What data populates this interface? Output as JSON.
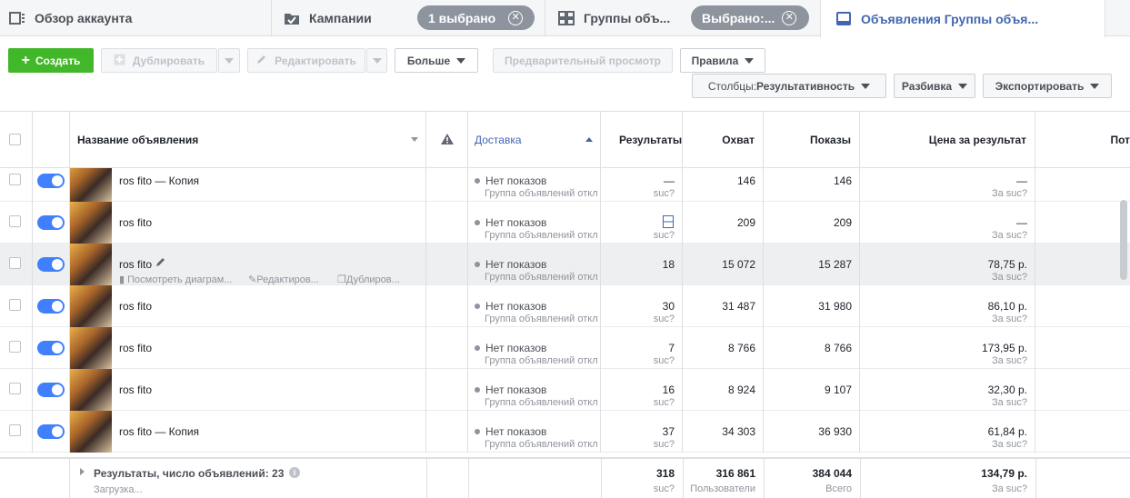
{
  "tabs": {
    "overview": "Обзор аккаунта",
    "campaigns": "Кампании",
    "campaigns_pill": "1 выбрано",
    "adsets": "Группы объ...",
    "adsets_pill": "Выбрано:...",
    "ads": "Объявления Группы объя..."
  },
  "toolbar": {
    "create": "Создать",
    "duplicate": "Дублировать",
    "edit": "Редактировать",
    "more": "Больше",
    "preview": "Предварительный просмотр",
    "rules": "Правила",
    "columns_label": "Столбцы: ",
    "columns_value": "Результативность",
    "breakdown": "Разбивка",
    "export": "Экспортировать"
  },
  "columns": {
    "name": "Название объявления",
    "delivery": "Доставка",
    "results": "Результаты",
    "reach": "Охват",
    "impressions": "Показы",
    "cost": "Цена за результат",
    "last": "Пот"
  },
  "rows": [
    {
      "name": "ros fito — Копия",
      "delivery": "Нет показов",
      "delivery_sub": "Группа объявлений откл",
      "results": "—",
      "results_sub": "suc?",
      "reach": "146",
      "impressions": "146",
      "cost": "—",
      "cost_sub": "За suc?"
    },
    {
      "name": "ros fito",
      "delivery": "Нет показов",
      "delivery_sub": "Группа объявлений откл",
      "results": "",
      "results_sub": "suc?",
      "reach": "209",
      "impressions": "209",
      "cost": "—",
      "cost_sub": "За suc?"
    },
    {
      "name": "ros fito",
      "delivery": "Нет показов",
      "delivery_sub": "Группа объявлений откл",
      "results": "18",
      "results_sub": "",
      "reach": "15 072",
      "impressions": "15 287",
      "cost": "78,75 р.",
      "cost_sub": "За suc?"
    },
    {
      "name": "ros fito",
      "delivery": "Нет показов",
      "delivery_sub": "Группа объявлений откл",
      "results": "30",
      "results_sub": "suc?",
      "reach": "31 487",
      "impressions": "31 980",
      "cost": "86,10 р.",
      "cost_sub": "За suc?"
    },
    {
      "name": "ros fito",
      "delivery": "Нет показов",
      "delivery_sub": "Группа объявлений откл",
      "results": "7",
      "results_sub": "suc?",
      "reach": "8 766",
      "impressions": "8 766",
      "cost": "173,95 р.",
      "cost_sub": "За suc?"
    },
    {
      "name": "ros fito",
      "delivery": "Нет показов",
      "delivery_sub": "Группа объявлений откл",
      "results": "16",
      "results_sub": "suc?",
      "reach": "8 924",
      "impressions": "9 107",
      "cost": "32,30 р.",
      "cost_sub": "За suc?"
    },
    {
      "name": "ros fito — Копия",
      "delivery": "Нет показов",
      "delivery_sub": "Группа объявлений откл",
      "results": "37",
      "results_sub": "suc?",
      "reach": "34 303",
      "impressions": "36 930",
      "cost": "61,84 р.",
      "cost_sub": "За suc?"
    }
  ],
  "row_actions": {
    "view_charts": "Посмотреть диаграм...",
    "edit": "Редактиров...",
    "duplicate": "Дублиров..."
  },
  "footer": {
    "title": "Результаты, число объявлений: 23",
    "loading": "Загрузка...",
    "results": "318",
    "results_sub": "suc?",
    "reach": "316 861",
    "reach_sub": "Пользователи",
    "impressions": "384 044",
    "impressions_sub": "Всего",
    "cost": "134,79 р.",
    "cost_sub": "За suc?"
  },
  "colors": {
    "accent": "#4267b2",
    "green": "#42b72a",
    "toggle": "#4080ff"
  }
}
